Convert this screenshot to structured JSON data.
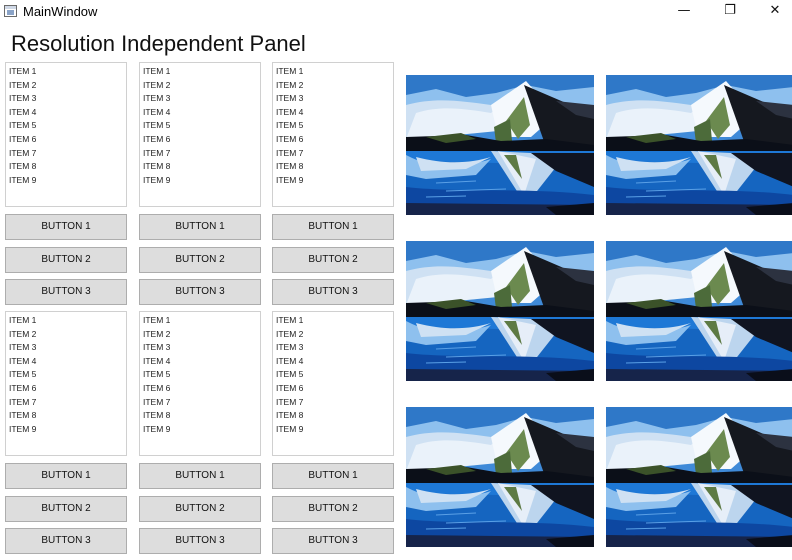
{
  "window": {
    "title": "MainWindow",
    "minimize_glyph": "—",
    "restore_glyph": "❐",
    "close_glyph": "✕",
    "icon": "window-app-icon"
  },
  "page": {
    "title": "Resolution Independent Panel"
  },
  "panels": [
    {
      "items": [
        "ITEM 1",
        "ITEM 2",
        "ITEM 3",
        "ITEM 4",
        "ITEM 5",
        "ITEM 6",
        "ITEM 7",
        "ITEM 8",
        "ITEM 9"
      ],
      "buttons": [
        "BUTTON 1",
        "BUTTON 2",
        "BUTTON 3"
      ]
    },
    {
      "items": [
        "ITEM 1",
        "ITEM 2",
        "ITEM 3",
        "ITEM 4",
        "ITEM 5",
        "ITEM 6",
        "ITEM 7",
        "ITEM 8",
        "ITEM 9"
      ],
      "buttons": [
        "BUTTON 1",
        "BUTTON 2",
        "BUTTON 3"
      ]
    },
    {
      "items": [
        "ITEM 1",
        "ITEM 2",
        "ITEM 3",
        "ITEM 4",
        "ITEM 5",
        "ITEM 6",
        "ITEM 7",
        "ITEM 8",
        "ITEM 9"
      ],
      "buttons": [
        "BUTTON 1",
        "BUTTON 2",
        "BUTTON 3"
      ]
    },
    {
      "items": [
        "ITEM 1",
        "ITEM 2",
        "ITEM 3",
        "ITEM 4",
        "ITEM 5",
        "ITEM 6",
        "ITEM 7",
        "ITEM 8",
        "ITEM 9"
      ],
      "buttons": [
        "BUTTON 1",
        "BUTTON 2",
        "BUTTON 3"
      ]
    },
    {
      "items": [
        "ITEM 1",
        "ITEM 2",
        "ITEM 3",
        "ITEM 4",
        "ITEM 5",
        "ITEM 6",
        "ITEM 7",
        "ITEM 8",
        "ITEM 9"
      ],
      "buttons": [
        "BUTTON 1",
        "BUTTON 2",
        "BUTTON 3"
      ]
    },
    {
      "items": [
        "ITEM 1",
        "ITEM 2",
        "ITEM 3",
        "ITEM 4",
        "ITEM 5",
        "ITEM 6",
        "ITEM 7",
        "ITEM 8",
        "ITEM 9"
      ],
      "buttons": [
        "BUTTON 1",
        "BUTTON 2",
        "BUTTON 3"
      ]
    }
  ],
  "image_grid": {
    "tile_count": 6,
    "subject": "mountain-lake-landscape",
    "colors": {
      "sky": "#4a90d9",
      "water": "#1565c0",
      "snow": "#e8f0f8",
      "shore": "#0a0f1a"
    }
  }
}
